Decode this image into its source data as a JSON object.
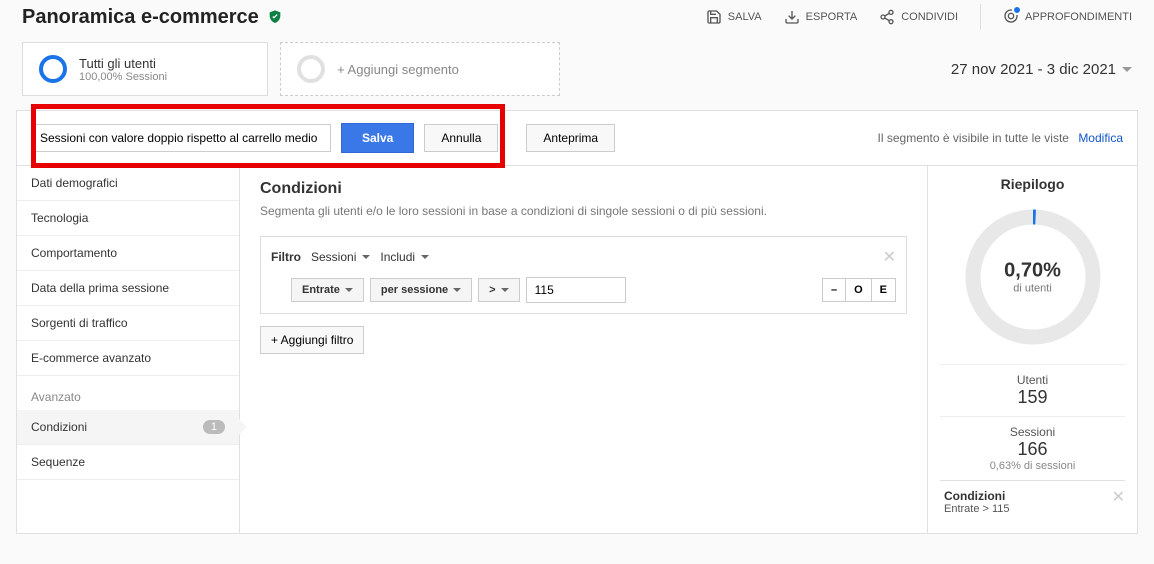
{
  "header": {
    "title": "Panoramica e-commerce",
    "actions": {
      "save": "SALVA",
      "export": "ESPORTA",
      "share": "CONDIVIDI",
      "insights": "APPROFONDIMENTI"
    }
  },
  "segments": {
    "primary": {
      "name": "Tutti gli utenti",
      "sub": "100,00% Sessioni"
    },
    "add": "+ Aggiungi segmento",
    "date_range": "27 nov 2021 - 3 dic 2021"
  },
  "builder": {
    "name_input": "Sessioni con valore doppio rispetto al carrello medio",
    "save": "Salva",
    "cancel": "Annulla",
    "preview": "Anteprima",
    "visibility": "Il segmento è visibile in tutte le viste",
    "edit": "Modifica"
  },
  "sidebar": {
    "items": [
      "Dati demografici",
      "Tecnologia",
      "Comportamento",
      "Data della prima sessione",
      "Sorgenti di traffico",
      "E-commerce avanzato"
    ],
    "advanced_label": "Avanzato",
    "conditions": "Condizioni",
    "conditions_badge": "1",
    "sequences": "Sequenze"
  },
  "conditions": {
    "title": "Condizioni",
    "desc": "Segmenta gli utenti e/o le loro sessioni in base a condizioni di singole sessioni o di più sessioni.",
    "filter_label": "Filtro",
    "scope": "Sessioni",
    "include": "Includi",
    "metric": "Entrate",
    "per": "per sessione",
    "operator": ">",
    "value": "115",
    "logic": {
      "minus": "–",
      "or": "O",
      "and": "E"
    },
    "add_filter": "+ Aggiungi filtro"
  },
  "summary": {
    "title": "Riepilogo",
    "pct": "0,70%",
    "pct_label": "di utenti",
    "users_label": "Utenti",
    "users": "159",
    "sessions_label": "Sessioni",
    "sessions": "166",
    "sessions_pct": "0,63% di sessioni",
    "cond_title": "Condizioni",
    "cond_text": "Entrate > 115"
  }
}
